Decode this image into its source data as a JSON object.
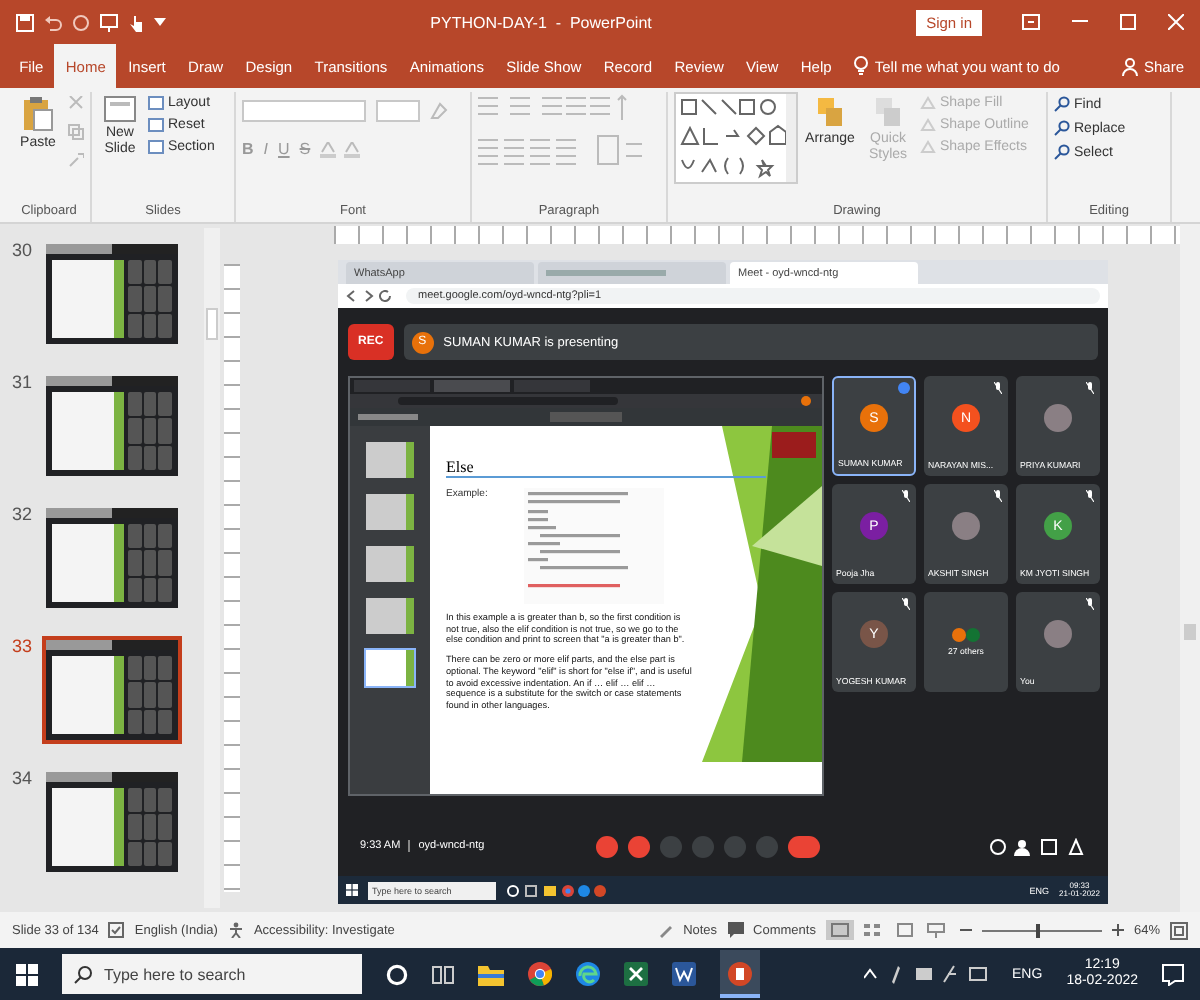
{
  "window": {
    "title": "PYTHON-DAY-1  -  PowerPoint",
    "sign_in": "Sign in"
  },
  "ribbon_tabs": [
    {
      "label": "File",
      "selected": false
    },
    {
      "label": "Home",
      "selected": true
    },
    {
      "label": "Insert",
      "selected": false
    },
    {
      "label": "Draw",
      "selected": false
    },
    {
      "label": "Design",
      "selected": false
    },
    {
      "label": "Transitions",
      "selected": false
    },
    {
      "label": "Animations",
      "selected": false
    },
    {
      "label": "Slide Show",
      "selected": false
    },
    {
      "label": "Record",
      "selected": false
    },
    {
      "label": "Review",
      "selected": false
    },
    {
      "label": "View",
      "selected": false
    },
    {
      "label": "Help",
      "selected": false
    }
  ],
  "tell_me": "Tell me what you want to do",
  "share": "Share",
  "ribbon_groups": [
    {
      "kind": "clipboard",
      "label": "Clipboard",
      "large": [
        {
          "label": "Paste",
          "disabled": false
        }
      ]
    },
    {
      "kind": "slides",
      "label": "Slides",
      "large": [
        {
          "label": "New Slide",
          "disabled": false
        }
      ],
      "small": [
        {
          "label": "Layout",
          "disabled": false
        },
        {
          "label": "Reset",
          "disabled": false
        },
        {
          "label": "Section",
          "disabled": false
        }
      ]
    },
    {
      "kind": "font",
      "label": "Font",
      "format": [
        "B",
        "I",
        "U",
        "S"
      ]
    },
    {
      "kind": "paragraph",
      "label": "Paragraph"
    },
    {
      "kind": "drawing",
      "label": "Drawing",
      "large": [
        {
          "label": "Arrange",
          "disabled": false
        },
        {
          "label": "Quick Styles",
          "disabled": true
        }
      ],
      "small": [
        {
          "label": "Shape Fill",
          "disabled": true
        },
        {
          "label": "Shape Outline",
          "disabled": true
        },
        {
          "label": "Shape Effects",
          "disabled": true
        }
      ]
    },
    {
      "kind": "editing",
      "label": "Editing",
      "small": [
        {
          "label": "Find",
          "disabled": false
        },
        {
          "label": "Replace",
          "disabled": false
        },
        {
          "label": "Select",
          "disabled": false
        }
      ]
    }
  ],
  "thumbnails": [
    {
      "number": "30",
      "selected": false
    },
    {
      "number": "31",
      "selected": false
    },
    {
      "number": "32",
      "selected": false
    },
    {
      "number": "33",
      "selected": true
    },
    {
      "number": "34",
      "selected": false
    }
  ],
  "slide": {
    "browser_tabs": [
      {
        "label": "WhatsApp",
        "selected": false
      },
      {
        "selected": false
      },
      {
        "label": "Meet - oyd-wncd-ntg",
        "selected": true
      }
    ],
    "url": "meet.google.com/oyd-wncd-ntg?pli=1",
    "rec": "REC",
    "presenter_initial": "S",
    "presenting": "SUMAN KUMAR is presenting",
    "shared": {
      "title": "Else",
      "example_label": "Example:",
      "paragraphs": [
        "In this example a is greater than b, so the first condition is not true, also the elif condition is not true, so we go to the else condition and print to screen that \"a is greater than b\".",
        "There can be zero or more elif parts, and the else part is optional. The keyword \"elif\" is short for \"else if\", and is useful to avoid excessive indentation. An if … elif … elif … sequence is a substitute for the switch or case statements found in other languages."
      ]
    },
    "participants": [
      {
        "kind": "initial",
        "initial": "S",
        "name": "SUMAN KUMAR",
        "color": "#e8710a",
        "selected": true,
        "muted": false
      },
      {
        "kind": "initial",
        "initial": "N",
        "name": "NARAYAN MIS...",
        "color": "#f4511e",
        "selected": false,
        "muted": true
      },
      {
        "kind": "photo",
        "name": "PRIYA KUMARI",
        "selected": false,
        "muted": true
      },
      {
        "kind": "initial",
        "initial": "P",
        "name": "Pooja Jha",
        "color": "#7b1fa2",
        "selected": false,
        "muted": true
      },
      {
        "kind": "photo",
        "name": "AKSHIT SINGH",
        "selected": false,
        "muted": true
      },
      {
        "kind": "initial",
        "initial": "K",
        "name": "KM JYOTI SINGH",
        "color": "#43a047",
        "selected": false,
        "muted": true
      },
      {
        "kind": "initial",
        "initial": "Y",
        "name": "YOGESH KUMAR",
        "color": "#795548",
        "selected": false,
        "muted": true
      },
      {
        "kind": "others",
        "name": "27 others",
        "selected": false,
        "muted": false
      },
      {
        "kind": "photo",
        "name": "You",
        "selected": false,
        "muted": true
      }
    ],
    "meeting_time": "9:33 AM",
    "meeting_code": "oyd-wncd-ntg",
    "taskbar": {
      "search_placeholder": "Type here to search",
      "language": "ENG",
      "time": "09:33",
      "date": "21-01-2022"
    }
  },
  "status_bar": {
    "slide": "Slide 33 of 134",
    "language": "English (India)",
    "accessibility": "Accessibility: Investigate",
    "notes": "Notes",
    "comments": "Comments",
    "zoom": {
      "level": 0.45
    },
    "zoom_reading": "64%"
  },
  "taskbar": {
    "search_placeholder": "Type here to search",
    "language": "ENG",
    "time": "12:19",
    "date": "18-02-2022"
  }
}
